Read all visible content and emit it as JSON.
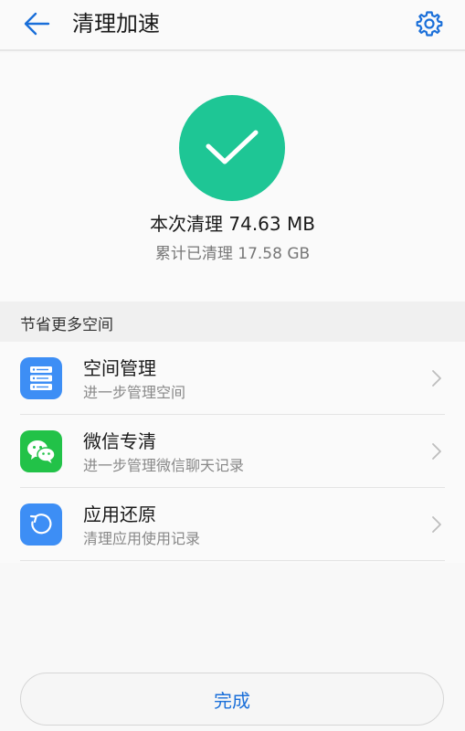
{
  "header": {
    "title": "清理加速",
    "back_icon": "arrow-left-icon",
    "settings_icon": "gear-icon"
  },
  "summary": {
    "status_icon": "check-icon",
    "cleaned_now": "本次清理 74.63 MB",
    "cleaned_total": "累计已清理 17.58 GB"
  },
  "section": {
    "title": "节省更多空间"
  },
  "items": [
    {
      "title": "空间管理",
      "subtitle": "进一步管理空间",
      "icon": "storage-icon",
      "icon_color": "#3d8ef5"
    },
    {
      "title": "微信专清",
      "subtitle": "进一步管理微信聊天记录",
      "icon": "wechat-icon",
      "icon_color": "#22c248"
    },
    {
      "title": "应用还原",
      "subtitle": "清理应用使用记录",
      "icon": "restore-icon",
      "icon_color": "#3d8ef5"
    }
  ],
  "footer": {
    "done_label": "完成"
  },
  "colors": {
    "accent": "#1a6fd9",
    "success": "#1ec695"
  }
}
